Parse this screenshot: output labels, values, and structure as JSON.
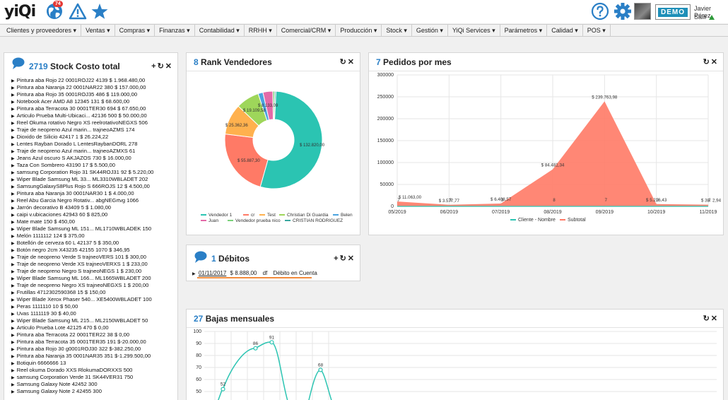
{
  "app": {
    "logo_text": "yiQi",
    "notification_badge": "74",
    "user_name": "Javier Pérez",
    "logout_label": "Salir",
    "demo_label": "DEMO"
  },
  "menu": [
    "Clientes y proveedores",
    "Ventas",
    "Compras",
    "Finanzas",
    "Contabilidad",
    "RRHH",
    "Comercial/CRM",
    "Producción",
    "Stock",
    "Gestión",
    "YiQi Services",
    "Parámetros",
    "Calidad",
    "POS"
  ],
  "stock_panel": {
    "count": "2719",
    "title": "Stock Costo total",
    "items": [
      "Pintura aba Rojo 22   0001ROJ22   4139   $ 1.968.480,00",
      "Pintura aba Naranja 22   0001NAR22   380   $ 157.000,00",
      "Pintura aba Rojo 35   0001ROJ35   486   $ 119.000,00",
      "Notebook Acer AMD A8   12345   131   $ 68.600,00",
      "Pintura aba Terracota 30   0001TER30   694   $ 67.650,00",
      "Articulo Prueba Multi-Ubicaci...   42136   500   $ 50.000,00",
      "Reel Okuma rotativo Negro XS   reelrotativoNEGXS   506",
      "Traje de neopreno Azul marin...   trajneoAZMS   174",
      "Dioxido de Silicio   42417   1   $ 26.224,22",
      "Lentes Rayban Dorado L   LentesRaybanDORL   278",
      "Traje de neopreno Azul marin...   trajneoAZMXS   61",
      "Jeans Azul oscuro S   AKJAZOS   730   $ 16.000,00",
      "Taza Con Sombrero   43190   17   $ 5.500,00",
      "samsung Corporation Rojo 31   SK44ROJ31   92   $ 5.220,00",
      "Wiper Blade Samsung ML 33...   ML3310WBLADET   202",
      "SamsungGalaxyS8Plus Rojo S   666ROJS   12   $ 4.500,00",
      "Pintura aba Naranja 30   0001NAR30   1   $ 4.000,00",
      "Reel Abu Garcia Negro Rotativ...   abgNEGrtvg   1066",
      "Jarrón decorativo B   43409   5   $ 1.080,00",
      "caipi v.ubicaciones   42943   60   $ 825,00",
      "Mate   mate   150   $ 450,00",
      "Wiper Blade Samsung ML 151...   ML1710WBLADEK   150",
      "Melón   1111112   124   $ 375,00",
      "Botellón de cerveza 60 L   42137   5   $ 350,00",
      "Botón negro 2cm X43235   42155   1070   $ 346,95",
      "Traje de neopreno Verde S   trajneoVERS   101   $ 300,00",
      "Traje de neopreno Verde XS   trajneoVERXS   1   $ 233,00",
      "Traje de neopreno Negro S   trajneoNEGS   1   $ 230,00",
      "Wiper Blade Samsung ML 166...   ML1665WBLADET   200",
      "Traje de neopreno Negro XS   trajneoNEGXS   1   $ 200,00",
      "Frutillas   4712302590368   15   $ 150,00",
      "Wiper Blade Xerox Phaser 540...   XE5400WBLADET   100",
      "Peras   1111110   10   $ 50,00",
      "Uvas   1111119   30   $ 40,00",
      "Wiper Blade Samsung ML 215...   ML2150WBLADET   50",
      "Articulo Prueba Lote   42125   470   $ 0,00",
      "Pintura aba Terracota 22   0001TER22   38   $ 0,00",
      "Pintura aba Terracota 35   0001TER35   191   $-20.000,00",
      "Pintura aba Rojo 30   g0001ROJ30   322   $-382.250,00",
      "Pintura aba Naranja 35   0001NAR35   351   $-1.299.500,00",
      "Botiquin   6666666   13",
      "Reel okuma Dorado XXS   RlokumaDORXXS   500",
      "samsung Corporation Verde 31   SK44VER31   750",
      "Samsung Galaxy Note   42452   300",
      "Samsung Galaxy Note 2   42455   300"
    ]
  },
  "rank_panel": {
    "count": "8",
    "title": "Rank Vendedores",
    "labels": [
      "$ 132.820,00",
      "$ 55.887,30",
      "$ 25.362,36",
      "$ 19.109,58",
      "$ 8.133,09"
    ],
    "legend": [
      "Vendedor 1",
      "cr",
      "Test",
      "Christian Di Guardia",
      "Belen",
      "Juan",
      "Vendedor prueba nico",
      "CRISTIAN RODRIGUEZ"
    ]
  },
  "pedidos_panel": {
    "count": "7",
    "title": "Pedidos por mes",
    "value_labels": [
      "$ 11.063,00",
      "$ 3.577,77",
      "$ 6.408,57",
      "$ 84.481,34",
      "$ 239.763,98",
      "$ 5.216,43",
      "$ 38",
      "2,94"
    ],
    "count_labels": [
      "7",
      "3",
      "3",
      "8",
      "7",
      "3",
      "2"
    ],
    "legend": [
      "Cliente - Nombre",
      "Subtotal"
    ]
  },
  "debitos_panel": {
    "count": "1",
    "title": "Débitos",
    "item_date": "01/11/2017",
    "item_amount": "$ 8.888,00",
    "item_type": "df",
    "item_desc": "Débito en Cuenta"
  },
  "bajas_panel": {
    "count": "27",
    "title": "Bajas mensuales"
  },
  "chart_data": [
    {
      "type": "pie",
      "title": "Rank Vendedores",
      "labels": [
        "Vendedor 1",
        "cr",
        "Test",
        "Christian Di Guardia",
        "Belen",
        "Juan",
        "Vendedor prueba nico",
        "CRISTIAN RODRIGUEZ"
      ],
      "values": [
        132820,
        55887.3,
        25362.36,
        19109.58,
        4000,
        8133.09,
        1500,
        1000
      ],
      "colors": [
        "#2bc4b2",
        "#ff7a66",
        "#ffb14e",
        "#9ed65a",
        "#4aa3df",
        "#e36aa8",
        "#7ad17a",
        "#3aa7a0"
      ]
    },
    {
      "type": "area",
      "title": "Pedidos por mes",
      "categories": [
        "05/2019",
        "06/2019",
        "07/2019",
        "08/2019",
        "09/2019",
        "10/2019",
        "11/2019"
      ],
      "series": [
        {
          "name": "Cliente - Nombre",
          "values": [
            7,
            3,
            3,
            8,
            7,
            3,
            2
          ],
          "color": "#2bc4b2"
        },
        {
          "name": "Subtotal",
          "values": [
            11063,
            3577.77,
            6408.57,
            84481.34,
            239763.98,
            5216.43,
            3882.94
          ],
          "color": "#ff7a66"
        }
      ],
      "ylim": [
        0,
        300000
      ],
      "yticks": [
        0,
        50000,
        100000,
        150000,
        200000,
        250000,
        300000
      ]
    },
    {
      "type": "line",
      "title": "Bajas mensuales",
      "ylim": [
        0,
        100
      ],
      "yticks": [
        50,
        60,
        70,
        80,
        90,
        100
      ],
      "points": [
        {
          "x": 1,
          "y": 52
        },
        {
          "x": 3,
          "y": 86
        },
        {
          "x": 4,
          "y": 91
        },
        {
          "x": 7,
          "y": 68
        }
      ],
      "color": "#2bc4b2"
    }
  ]
}
